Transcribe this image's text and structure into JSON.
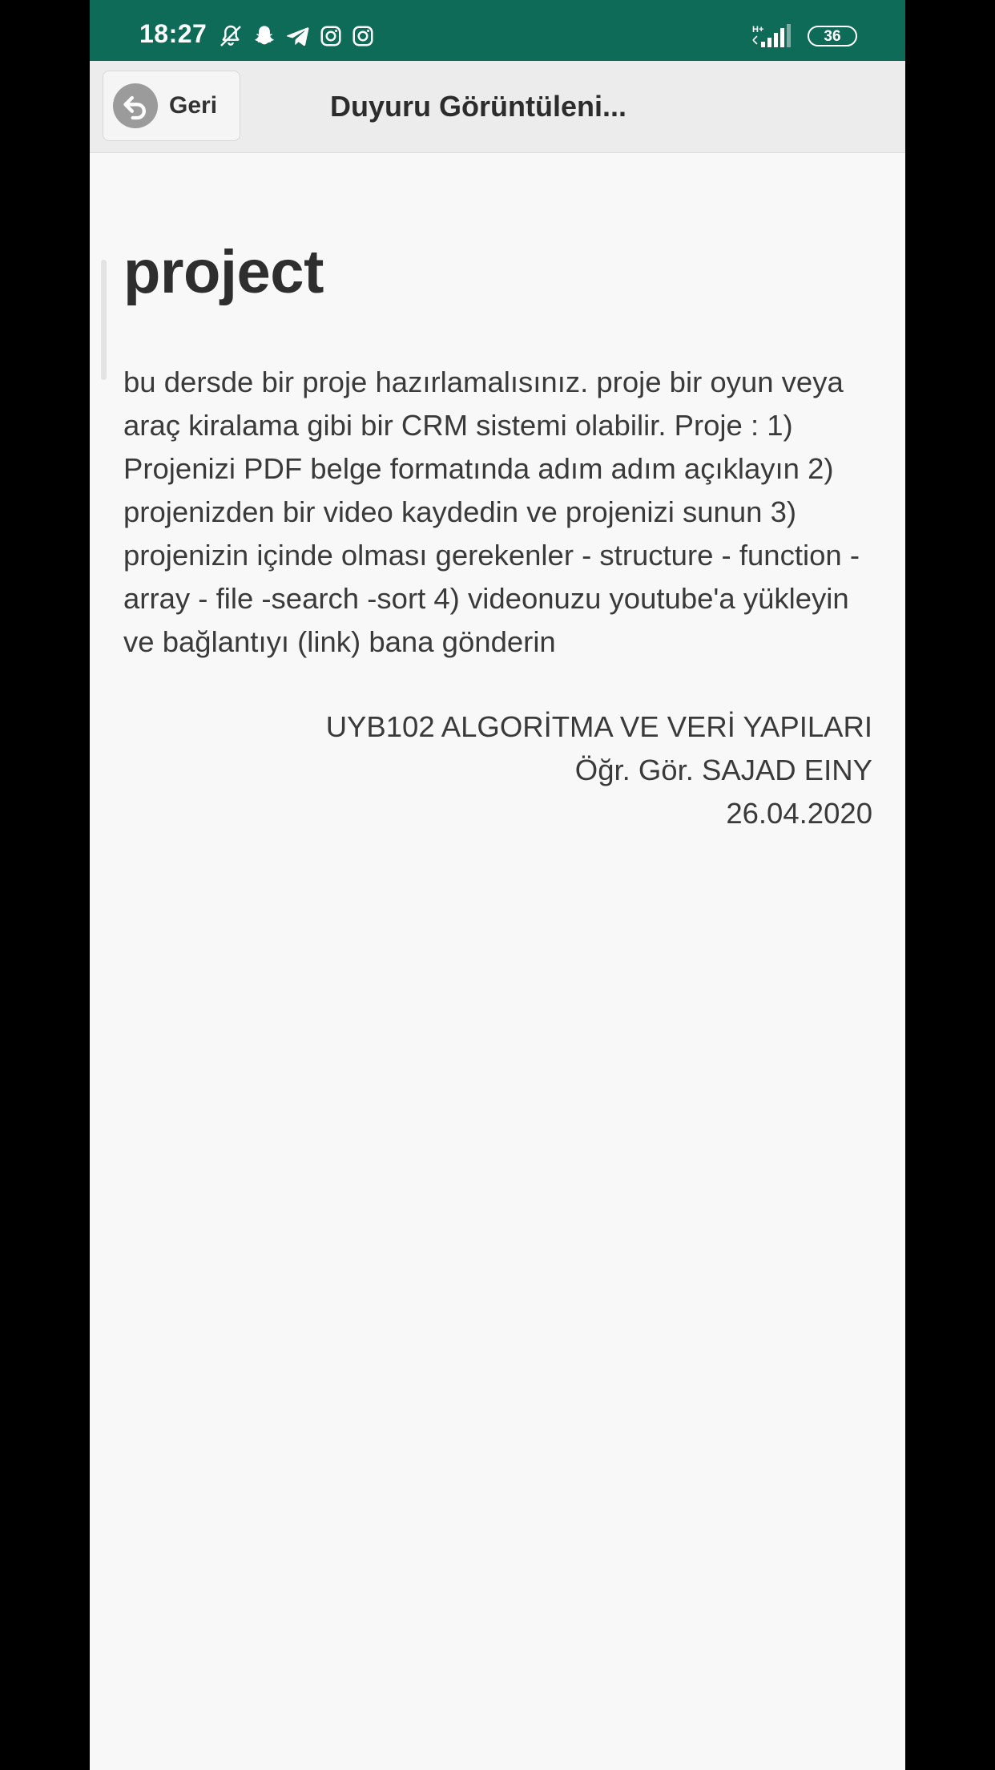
{
  "status_bar": {
    "time": "18:27",
    "network": "H+",
    "battery": "36",
    "icons": [
      "muted-bell-icon",
      "snapchat-icon",
      "telegram-icon",
      "instagram-icon",
      "instagram-icon",
      "signal-icon",
      "battery-icon"
    ],
    "background": "#0d6b58"
  },
  "app_bar": {
    "back_label": "Geri",
    "title": "Duyuru Görüntüleni..."
  },
  "announcement": {
    "title": "project",
    "body": "bu dersde bir proje hazırlamalısınız. proje bir oyun veya araç kiralama gibi bir CRM sistemi olabilir. Proje : 1) Projenizi PDF belge formatında adım adım açıklayın 2) projenizden bir video kaydedin ve projenizi sunun 3) projenizin içinde olması gerekenler - structure - function - array - file -search -sort 4) videonuzu youtube'a yükleyin ve bağlantıyı (link) bana gönderin",
    "course": "UYB102 ALGORİTMA VE VERİ YAPILARI",
    "instructor": "Öğr. Gör. SAJAD EINY",
    "date": "26.04.2020"
  }
}
